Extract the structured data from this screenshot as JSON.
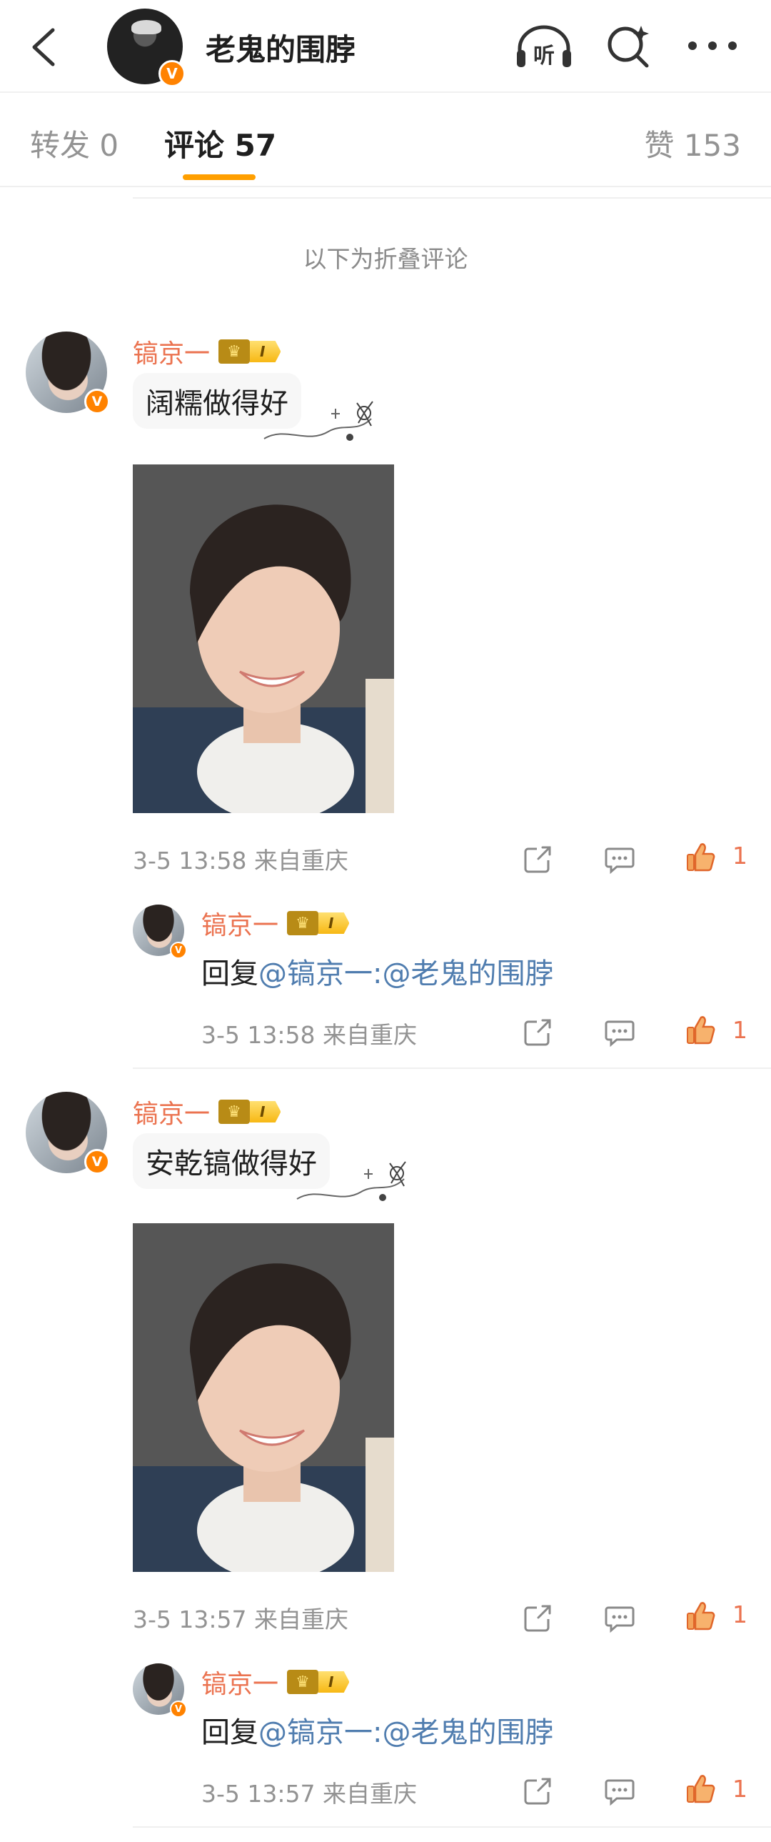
{
  "header": {
    "title": "老鬼的围脖",
    "listen_label": "听"
  },
  "tabs": {
    "repost": "转发 0",
    "comments": "评论 57",
    "likes": "赞 153"
  },
  "fold_note": "以下为折叠评论",
  "comments": [
    {
      "username": "镐京一",
      "level": "I",
      "text": "阔糯做得好",
      "meta": "3-5 13:58  来自重庆",
      "likes": "1",
      "reply": {
        "username": "镐京一",
        "level": "I",
        "prefix": "回复",
        "mention": "@镐京一:@老鬼的围脖",
        "meta": "3-5 13:58  来自重庆",
        "likes": "1"
      }
    },
    {
      "username": "镐京一",
      "level": "I",
      "text": "安乾镐做得好",
      "meta": "3-5 13:57  来自重庆",
      "likes": "1",
      "reply": {
        "username": "镐京一",
        "level": "I",
        "prefix": "回复",
        "mention": "@镐京一:@老鬼的围脖",
        "meta": "3-5 13:57  来自重庆",
        "likes": "1"
      }
    }
  ],
  "icons": {
    "verified": "V",
    "crown": "♛"
  },
  "colors": {
    "accent": "#ff8200",
    "username": "#eb7350",
    "link": "#507daf",
    "tab_underline": "#ff9f00"
  }
}
